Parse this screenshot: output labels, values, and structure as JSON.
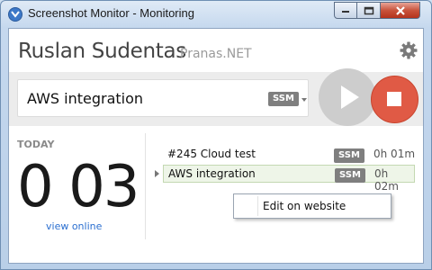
{
  "window": {
    "title": "Screenshot Monitor - Monitoring"
  },
  "header": {
    "user_name": "Ruslan Sudentas",
    "organization": "Pranas.NET"
  },
  "project": {
    "name": "AWS integration",
    "tag": "SSM"
  },
  "today": {
    "label": "TODAY",
    "time": "0 03",
    "view_online": "view online"
  },
  "tasks": [
    {
      "title": "#245 Cloud test",
      "tag": "SSM",
      "duration": "0h 01m"
    },
    {
      "title": "AWS integration",
      "tag": "SSM",
      "duration": "0h 02m"
    }
  ],
  "context_menu": {
    "items": [
      "Edit on website"
    ]
  },
  "colors": {
    "stop_button": "#e05a45",
    "play_button": "#cdcdcd",
    "link": "#2b6fd0",
    "selected_row": "#eef5e8"
  }
}
